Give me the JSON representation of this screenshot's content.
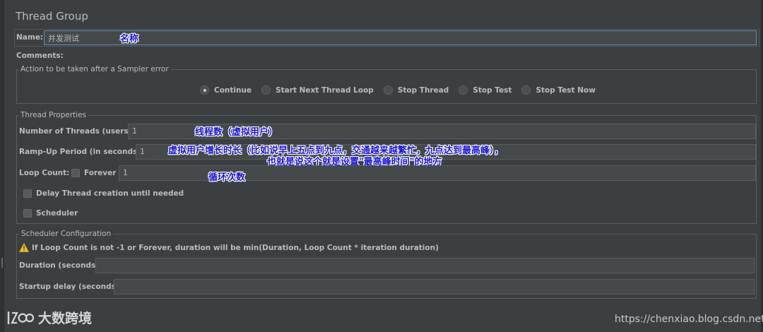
{
  "panel": {
    "title": "Thread Group"
  },
  "name": {
    "label": "Name:",
    "value": "并发测试"
  },
  "comments": {
    "label": "Comments:"
  },
  "sampler_error": {
    "legend": "Action to be taken after a Sampler error",
    "options": [
      {
        "label": "Continue",
        "selected": true
      },
      {
        "label": "Start Next Thread Loop",
        "selected": false
      },
      {
        "label": "Stop Thread",
        "selected": false
      },
      {
        "label": "Stop Test",
        "selected": false
      },
      {
        "label": "Stop Test Now",
        "selected": false
      }
    ]
  },
  "thread_props": {
    "legend": "Thread Properties",
    "threads_label": "Number of Threads (users):",
    "threads_value": "1",
    "rampup_label": "Ramp-Up Period (in seconds):",
    "rampup_value": "1",
    "loop_label": "Loop Count:",
    "forever_label": "Forever",
    "loop_value": "1",
    "delay_label": "Delay Thread creation until needed",
    "scheduler_label": "Scheduler"
  },
  "scheduler_config": {
    "legend": "Scheduler Configuration",
    "warning": "If Loop Count is not -1 or Forever, duration will be min(Duration, Loop Count * iteration duration)",
    "duration_label": "Duration (seconds)",
    "duration_value": "",
    "startup_label": "Startup delay (seconds)",
    "startup_value": ""
  },
  "annotations": {
    "name_note": "名称",
    "threads_note": "线程数（虚拟用户）",
    "rampup_note_1": "虚拟用户增长时长（比如说早上五点到九点，交通越来越繁忙，九点达到最高峰），",
    "rampup_note_2": "也就是说这个就是设置\"最高峰时间\"的地方",
    "loop_note": "循环次数"
  },
  "watermark": {
    "brand": "大数跨境",
    "url": "https://chenxiao.blog.csdn.net"
  },
  "colors": {
    "background": "#3c3f41",
    "text": "#bbbbbb",
    "annotation": "#1a14d6",
    "focus_border": "#5e8bb5"
  }
}
